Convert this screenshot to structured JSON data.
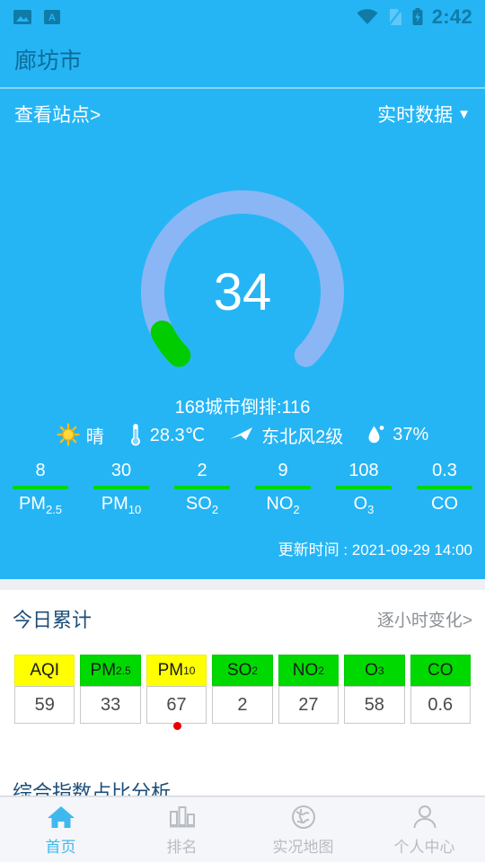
{
  "statusbar": {
    "time": "2:42",
    "icons": [
      "image-icon",
      "app-a-icon",
      "wifi-icon",
      "sim-card-off-icon",
      "battery-charging-icon"
    ]
  },
  "header": {
    "city": "廊坊市",
    "view_stations": "查看站点>",
    "data_mode": "实时数据",
    "data_mode_caret": "▼"
  },
  "gauge": {
    "value": "34",
    "max": 500,
    "progress_color": "#00cc00",
    "track_color": "#8ab6f5",
    "rank_text": "168城市倒排:116"
  },
  "weather": [
    {
      "icon": "sun-icon",
      "text": "晴"
    },
    {
      "icon": "thermometer-icon",
      "text": "28.3℃"
    },
    {
      "icon": "wind-icon",
      "text": "东北风2级"
    },
    {
      "icon": "humidity-drop-icon",
      "text": "37%"
    }
  ],
  "pollutants": [
    {
      "name": "PM",
      "sub": "2.5",
      "value": "8"
    },
    {
      "name": "PM",
      "sub": "10",
      "value": "30"
    },
    {
      "name": "SO",
      "sub": "2",
      "value": "2"
    },
    {
      "name": "NO",
      "sub": "2",
      "value": "9"
    },
    {
      "name": "O",
      "sub": "3",
      "value": "108"
    },
    {
      "name": "CO",
      "sub": "",
      "value": "0.3"
    }
  ],
  "update_time": "更新时间 : 2021-09-29 14:00",
  "today": {
    "title": "今日累计",
    "link": "逐小时变化>",
    "columns": [
      {
        "name": "AQI",
        "sub": "",
        "value": "59",
        "color": "#ffff00"
      },
      {
        "name": "PM",
        "sub": "2.5",
        "value": "33",
        "color": "#00d900"
      },
      {
        "name": "PM",
        "sub": "10",
        "value": "67",
        "color": "#ffff00"
      },
      {
        "name": "SO",
        "sub": "2",
        "value": "2",
        "color": "#00d900"
      },
      {
        "name": "NO",
        "sub": "2",
        "value": "27",
        "color": "#00d900"
      },
      {
        "name": "O",
        "sub": "3",
        "value": "58",
        "color": "#00d900"
      },
      {
        "name": "CO",
        "sub": "",
        "value": "0.6",
        "color": "#00d900"
      }
    ]
  },
  "section2": {
    "title": "综合指数占比分析"
  },
  "bottom_nav": [
    {
      "icon": "home-icon",
      "label": "首页",
      "active": true
    },
    {
      "icon": "bar-chart-icon",
      "label": "排名",
      "active": false
    },
    {
      "icon": "globe-icon",
      "label": "实况地图",
      "active": false
    },
    {
      "icon": "person-icon",
      "label": "个人中心",
      "active": false
    }
  ],
  "theme": {
    "primary_blue": "#25b5f5",
    "dark_blue_text": "#1d4e79",
    "green": "#00d900",
    "yellow": "#ffff00",
    "accent_dot": "#e60000"
  }
}
